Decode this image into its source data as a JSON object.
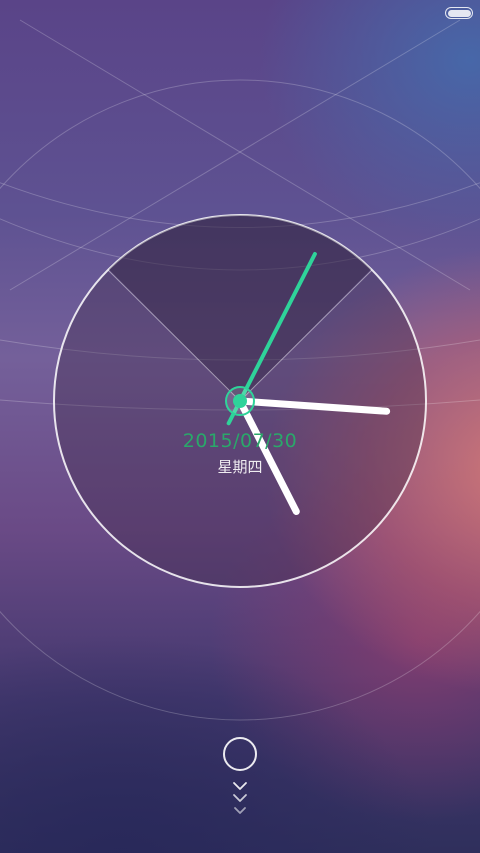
{
  "status_bar": {
    "battery_level": 1.0
  },
  "clock": {
    "date": "2015/07/30",
    "weekday": "星期四",
    "accent_color": "#2fd39a",
    "hands": {
      "hour_angle_deg": 94,
      "minute_angle_deg": 153,
      "second_angle_deg": 27
    }
  },
  "unlock": {
    "icon": "unlock-circle-icon",
    "hint_icon": "swipe-chevrons-icon"
  }
}
